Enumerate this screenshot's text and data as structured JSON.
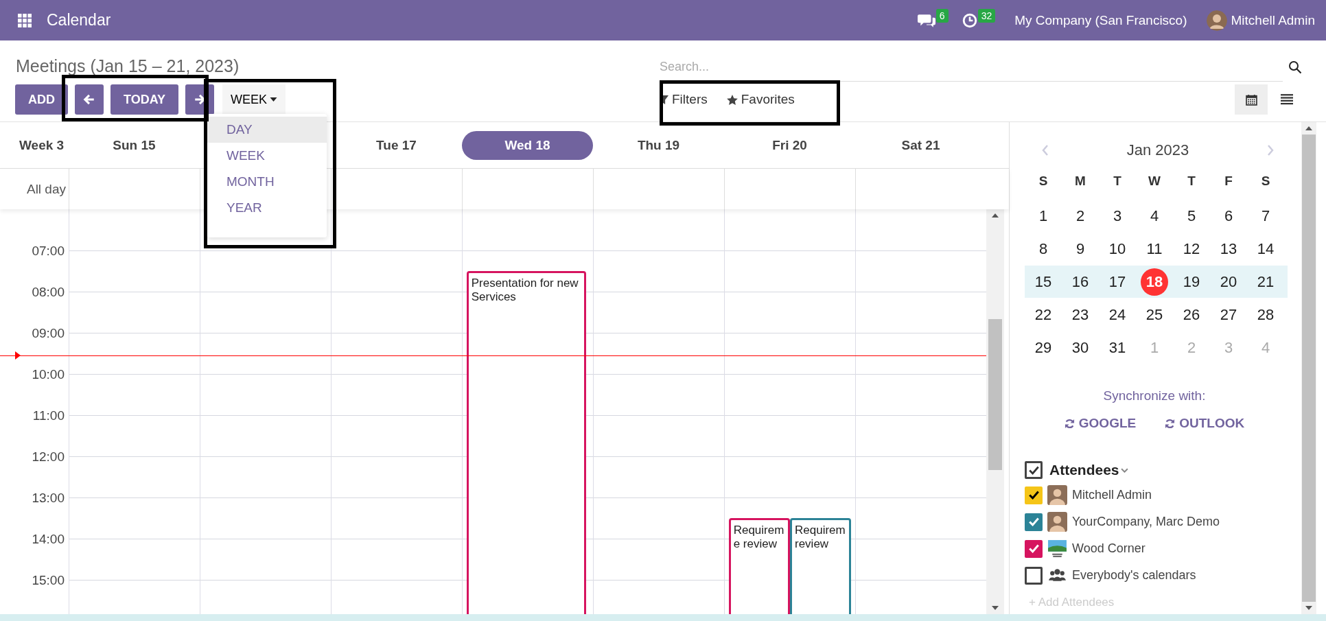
{
  "navbar": {
    "app_name": "Calendar",
    "messages_badge": "6",
    "activities_badge": "32",
    "company": "My Company (San Francisco)",
    "user": "Mitchell Admin"
  },
  "control_panel": {
    "title": "Meetings (Jan 15 – 21, 2023)",
    "search": {
      "placeholder": "Search..."
    },
    "add": "ADD",
    "today": "TODAY",
    "scale": "WEEK",
    "scale_menu": [
      {
        "label": "DAY",
        "selected": true
      },
      {
        "label": "WEEK",
        "selected": false
      },
      {
        "label": "MONTH",
        "selected": false
      },
      {
        "label": "YEAR",
        "selected": false
      }
    ],
    "filters": "Filters",
    "favorites": "Favorites",
    "views": [
      {
        "kind": "calendar",
        "selected": true
      },
      {
        "kind": "list",
        "selected": false
      }
    ]
  },
  "week": {
    "week_label": "Week 3",
    "all_day_label": "All day",
    "hours": [
      "07:00",
      "08:00",
      "09:00",
      "10:00",
      "11:00",
      "12:00",
      "13:00",
      "14:00",
      "15:00"
    ],
    "days": [
      {
        "label": "Sun 15",
        "today": false
      },
      {
        "label": "Tue 17",
        "today": false
      },
      {
        "label": "Wed 18",
        "today": true,
        "events": [
          {
            "title": "Presentation for new Services",
            "color": "#d6145f"
          }
        ]
      },
      {
        "label": "Thu 19",
        "today": false
      },
      {
        "label": "Fri 20",
        "today": false,
        "events": [
          {
            "title": "Requireme review",
            "color": "#d6145f"
          },
          {
            "title": "Requirem review",
            "color": "#2c8397"
          }
        ]
      },
      {
        "label": "Sat 21",
        "today": false
      }
    ]
  },
  "sidebar": {
    "month": "Jan 2023",
    "weekdays": [
      "S",
      "M",
      "T",
      "W",
      "T",
      "F",
      "S"
    ],
    "weeks": [
      {
        "selected": false,
        "days": [
          {
            "label": "1",
            "other_month": false,
            "today": false
          },
          {
            "label": "2",
            "other_month": false,
            "today": false
          },
          {
            "label": "3",
            "other_month": false,
            "today": false
          },
          {
            "label": "4",
            "other_month": false,
            "today": false
          },
          {
            "label": "5",
            "other_month": false,
            "today": false
          },
          {
            "label": "6",
            "other_month": false,
            "today": false
          },
          {
            "label": "7",
            "other_month": false,
            "today": false
          }
        ]
      },
      {
        "selected": false,
        "days": [
          {
            "label": "8",
            "other_month": false,
            "today": false
          },
          {
            "label": "9",
            "other_month": false,
            "today": false
          },
          {
            "label": "10",
            "other_month": false,
            "today": false
          },
          {
            "label": "11",
            "other_month": false,
            "today": false
          },
          {
            "label": "12",
            "other_month": false,
            "today": false
          },
          {
            "label": "13",
            "other_month": false,
            "today": false
          },
          {
            "label": "14",
            "other_month": false,
            "today": false
          }
        ]
      },
      {
        "selected": true,
        "days": [
          {
            "label": "15",
            "other_month": false,
            "today": false
          },
          {
            "label": "16",
            "other_month": false,
            "today": false
          },
          {
            "label": "17",
            "other_month": false,
            "today": false
          },
          {
            "label": "18",
            "other_month": false,
            "today": true
          },
          {
            "label": "19",
            "other_month": false,
            "today": false
          },
          {
            "label": "20",
            "other_month": false,
            "today": false
          },
          {
            "label": "21",
            "other_month": false,
            "today": false
          }
        ]
      },
      {
        "selected": false,
        "days": [
          {
            "label": "22",
            "other_month": false,
            "today": false
          },
          {
            "label": "23",
            "other_month": false,
            "today": false
          },
          {
            "label": "24",
            "other_month": false,
            "today": false
          },
          {
            "label": "25",
            "other_month": false,
            "today": false
          },
          {
            "label": "26",
            "other_month": false,
            "today": false
          },
          {
            "label": "27",
            "other_month": false,
            "today": false
          },
          {
            "label": "28",
            "other_month": false,
            "today": false
          }
        ]
      },
      {
        "selected": false,
        "days": [
          {
            "label": "29",
            "other_month": false,
            "today": false
          },
          {
            "label": "30",
            "other_month": false,
            "today": false
          },
          {
            "label": "31",
            "other_month": false,
            "today": false
          },
          {
            "label": "1",
            "other_month": true,
            "today": false
          },
          {
            "label": "2",
            "other_month": true,
            "today": false
          },
          {
            "label": "3",
            "other_month": true,
            "today": false
          },
          {
            "label": "4",
            "other_month": true,
            "today": false
          }
        ]
      }
    ],
    "sync_label": "Synchronize with:",
    "sync_buttons": [
      "GOOGLE",
      "OUTLOOK"
    ],
    "attendees": {
      "title": "Attendees",
      "checked": true,
      "add_placeholder": "+ Add Attendees",
      "items": [
        {
          "name": "Mitchell Admin",
          "checked": true,
          "color": "#f5c518",
          "kind": "person"
        },
        {
          "name": "YourCompany, Marc Demo",
          "checked": true,
          "color": "#2c8397",
          "kind": "person"
        },
        {
          "name": "Wood Corner",
          "checked": true,
          "color": "#d6145f",
          "kind": "logo"
        },
        {
          "name": "Everybody's calendars",
          "checked": false,
          "color": "#ffffff",
          "kind": "group"
        }
      ]
    }
  }
}
